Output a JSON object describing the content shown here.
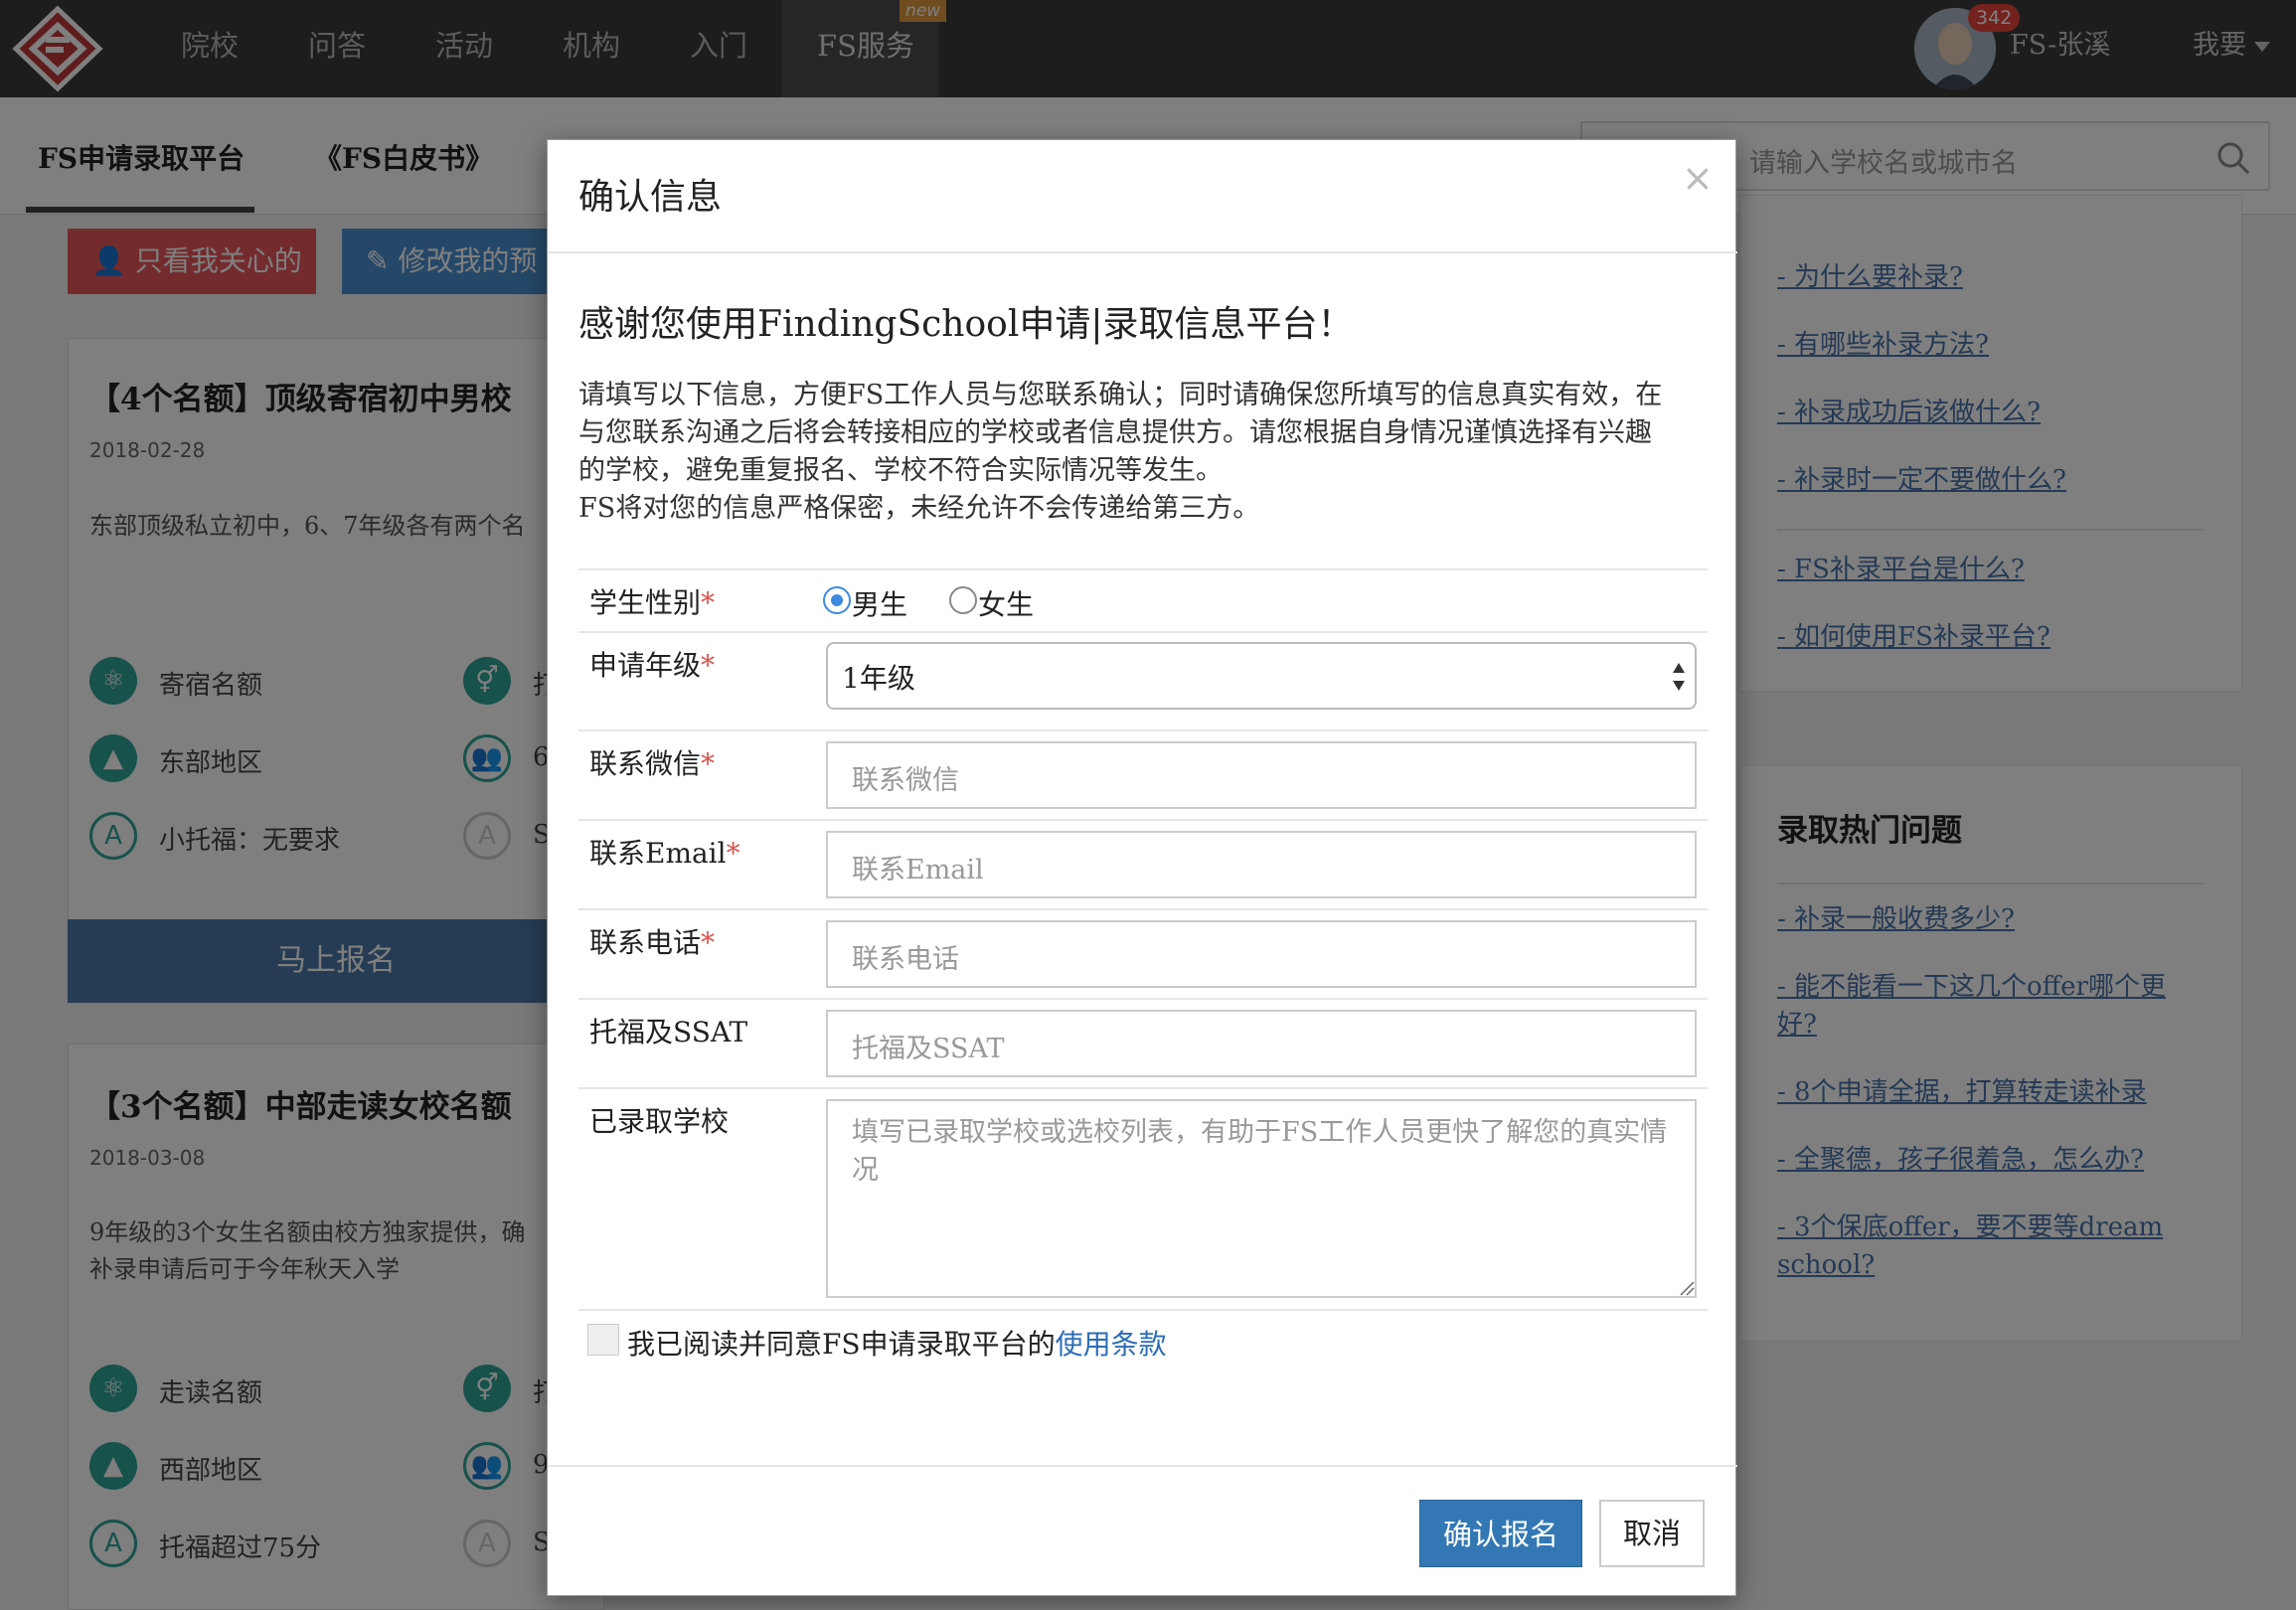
{
  "nav": {
    "items": [
      "院校",
      "问答",
      "活动",
      "机构",
      "入门",
      "FS服务"
    ],
    "new_badge": "new",
    "msg_count": "342",
    "user_name": "FS-张溪",
    "want": "我要"
  },
  "subnav": {
    "tabs": [
      "FS申请录取平台",
      "《FS白皮书》"
    ],
    "search_placeholder": "请输入学校名或城市名"
  },
  "left": {
    "btn_care": "只看我关心的",
    "btn_edit": "修改我的预",
    "signup": "马上报名",
    "cards": [
      {
        "title": "【4个名额】顶级寄宿初中男校",
        "date": "2018-02-28",
        "desc": "东部顶级私立初中，6、7年级各有两个名",
        "feat1": "寄宿名额",
        "feat1b": "打",
        "feat2": "东部地区",
        "feat2b": "6",
        "feat3": "小托福：无要求",
        "feat3b": "S"
      },
      {
        "title": "【3个名额】中部走读女校名额",
        "date": "2018-03-08",
        "desc": "9年级的3个女生名额由校方独家提供，确 补录申请后可于今年秋天入学",
        "feat1": "走读名额",
        "feat1b": "打",
        "feat2": "西部地区",
        "feat2b": "9",
        "feat3": "托福超过75分",
        "feat3b": "S"
      }
    ]
  },
  "sidebar": {
    "links_top": [
      "- 为什么要补录?",
      "- 有哪些补录方法?",
      "- 补录成功后该做什么?",
      "- 补录时一定不要做什么?",
      "- FS补录平台是什么?",
      "- 如何使用FS补录平台?"
    ],
    "hot_title": "录取热门问题",
    "hot_links": [
      "- 补录一般收费多少? ",
      "- 能不能看一下这几个offer哪个更好? ",
      "- 8个申请全据，打算转走读补录",
      "- 全聚德，孩子很着急，怎么办? ",
      "- 3个保底offer，要不要等dream school? "
    ]
  },
  "modal": {
    "title": "确认信息",
    "close": "×",
    "heading": "感谢您使用FindingSchool申请|录取信息平台！",
    "paragraph_lines": [
      "请填写以下信息，方便FS工作人员与您联系确认；同时请确保您所填写的信息真实有效，在",
      "与您联系沟通之后将会转接相应的学校或者信息提供方。请您根据自身情况谨慎选择有兴趣",
      "的学校，避免重复报名、学校不符合实际情况等发生。",
      "FS将对您的信息严格保密，未经允许不会传递给第三方。"
    ],
    "labels": {
      "gender": "学生性别",
      "grade": "申请年级",
      "wechat": "联系微信",
      "email": "联系Email",
      "phone": "联系电话",
      "toefl": "托福及SSAT",
      "admitted": "已录取学校"
    },
    "required_mark": "*",
    "gender_options": [
      "男生",
      "女生"
    ],
    "gender_selected": "男生",
    "grade_value": "1年级",
    "placeholders": {
      "wechat": "联系微信",
      "email": "联系Email",
      "phone": "联系电话",
      "toefl": "托福及SSAT",
      "admitted": "填写已录取学校或选校列表，有助于FS工作人员更快了解您的真实情况"
    },
    "agree_text": "我已阅读并同意FS申请录取平台的",
    "agree_link": "使用条款",
    "confirm_button": "确认报名",
    "cancel_button": "取消"
  }
}
